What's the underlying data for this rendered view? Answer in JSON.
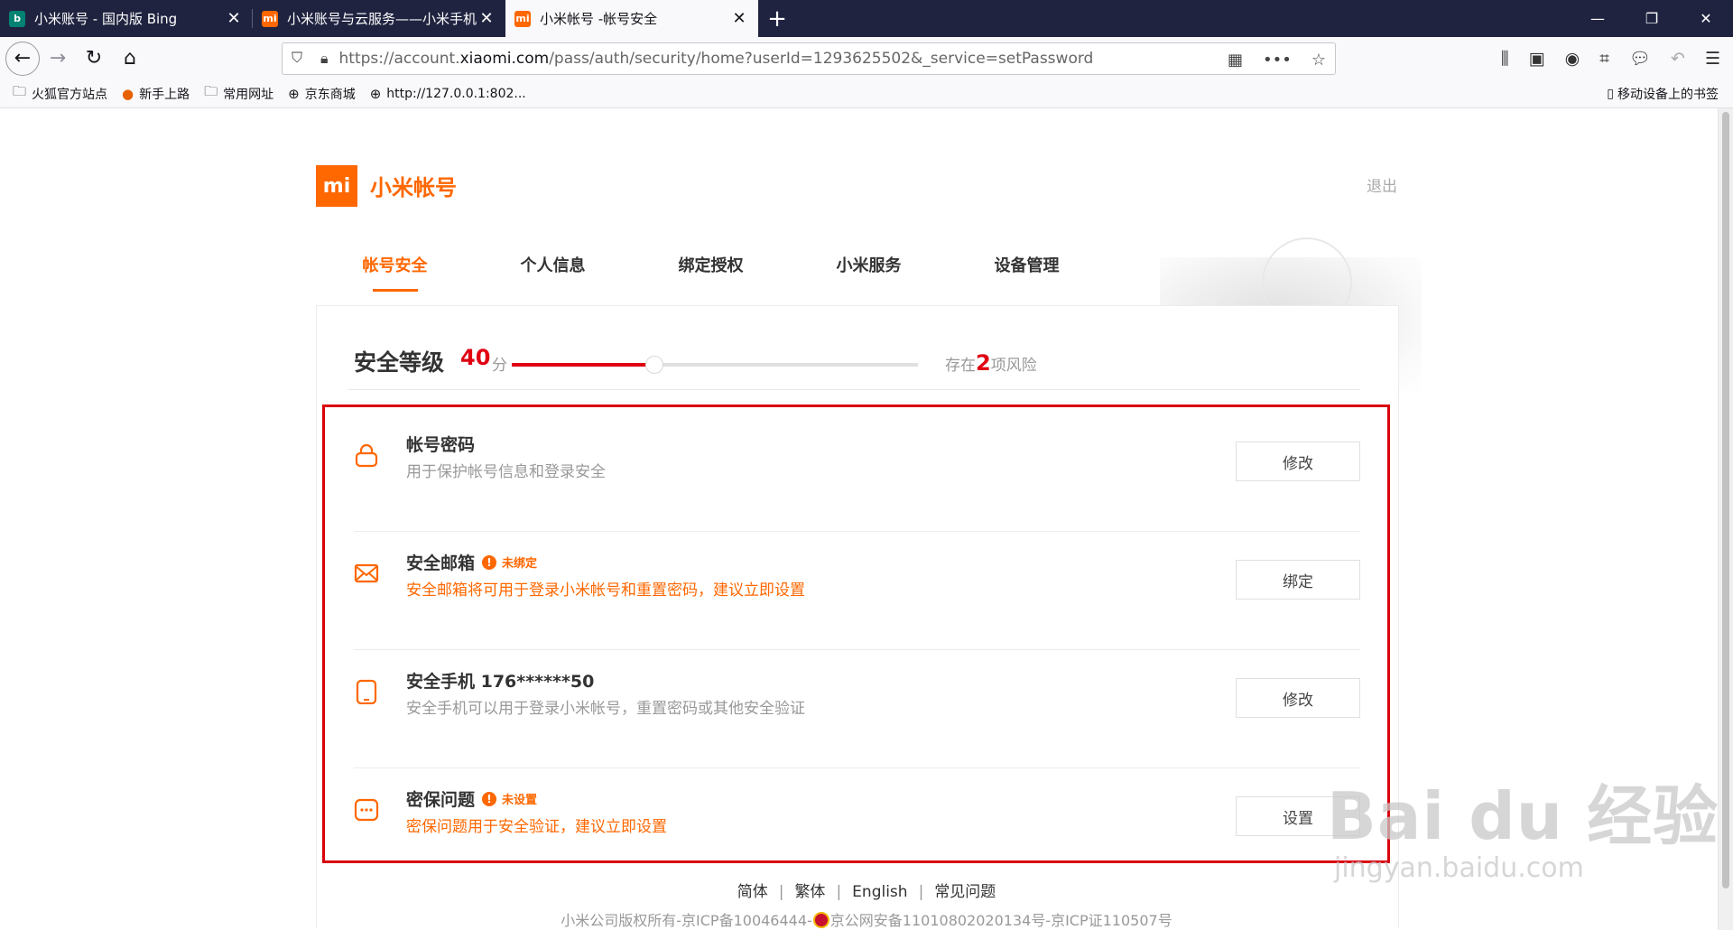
{
  "browser": {
    "tabs": [
      {
        "title": "小米账号 - 国内版 Bing",
        "icon": "bing-icon",
        "active": false
      },
      {
        "title": "小米账号与云服务——小米手机",
        "icon": "mi-icon",
        "active": false
      },
      {
        "title": "小米帐号 -帐号安全",
        "icon": "mi-icon",
        "active": true
      }
    ],
    "url_prefix": "https://account.",
    "url_domain": "xiaomi.com",
    "url_rest": "/pass/auth/security/home?userId=1293625502&_service=setPassword",
    "bookmarks": [
      {
        "label": "火狐官方站点",
        "icon": "folder-icon"
      },
      {
        "label": "新手上路",
        "icon": "firefox-icon"
      },
      {
        "label": "常用网址",
        "icon": "folder-icon"
      },
      {
        "label": "京东商城",
        "icon": "globe-icon"
      },
      {
        "label": "http://127.0.0.1:802...",
        "icon": "globe-icon"
      }
    ],
    "mobile_bookmarks": "移动设备上的书签"
  },
  "header": {
    "logo_text": "mi",
    "brand": "小米帐号",
    "logout": "退出"
  },
  "nav": {
    "items": [
      "帐号安全",
      "个人信息",
      "绑定授权",
      "小米服务",
      "设备管理"
    ],
    "active_index": 0
  },
  "security": {
    "title": "安全等级",
    "score": "40",
    "score_unit": "分",
    "level_fraction": 0.35,
    "risk_prefix": "存在",
    "risk_count": "2",
    "risk_suffix": "项风险",
    "accent_color": "#ff6700",
    "danger_color": "#e00012"
  },
  "items": [
    {
      "title": "帐号密码",
      "flag": "",
      "desc": "用于保护帐号信息和登录安全",
      "warn": false,
      "button": "修改",
      "icon": "lock-icon"
    },
    {
      "title": "安全邮箱",
      "flag": "未绑定",
      "desc": "安全邮箱将可用于登录小米帐号和重置密码，建议立即设置",
      "warn": true,
      "button": "绑定",
      "icon": "mail-icon"
    },
    {
      "title": "安全手机 176******50",
      "flag": "",
      "desc": "安全手机可以用于登录小米帐号，重置密码或其他安全验证",
      "warn": false,
      "button": "修改",
      "icon": "phone-icon"
    },
    {
      "title": "密保问题",
      "flag": "未设置",
      "desc": "密保问题用于安全验证，建议立即设置",
      "warn": true,
      "button": "设置",
      "icon": "question-icon"
    }
  ],
  "footer": {
    "links": [
      "简体",
      "繁体",
      "English",
      "常见问题"
    ],
    "copyright_a": "小米公司版权所有-京ICP备10046444-",
    "copyright_b": "京公网安备11010802020134号-京ICP证110507号"
  },
  "watermark": {
    "main": "Bai du 经验",
    "sub": "jingyan.baidu.com"
  }
}
